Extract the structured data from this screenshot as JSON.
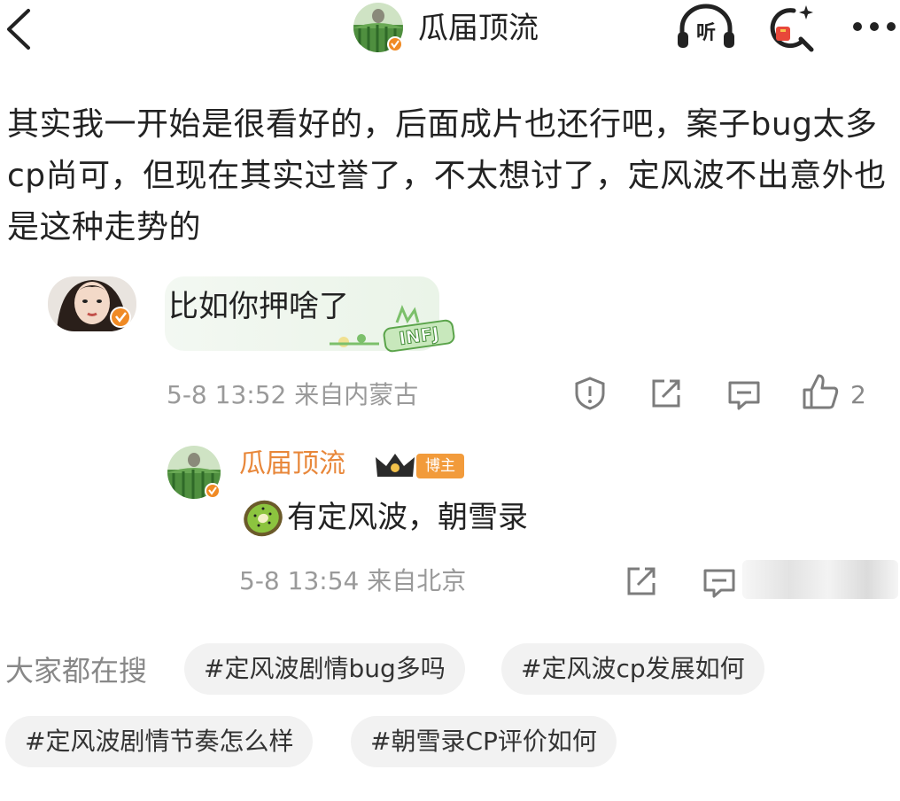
{
  "header": {
    "title": "瓜届顶流",
    "listen_label": "听"
  },
  "post": {
    "text": "其实我一开始是很看好的，后面成片也还行吧，案子bug太多cp尚可，但现在其实过誉了，不太想讨了，定风波不出意外也是这种走势的"
  },
  "reply": {
    "text": "比如你押啥了",
    "decoration_text": "INFJ",
    "meta": "5-8 13:52 来自内蒙古",
    "like_count": "2"
  },
  "nested_reply": {
    "author": "瓜届顶流",
    "badge": "博主",
    "text": "有定风波，朝雪录",
    "meta": "5-8 13:54 来自北京"
  },
  "search": {
    "label": "大家都在搜",
    "chips": [
      "#定风波剧情bug多吗",
      "#定风波cp发展如何",
      "#定风波剧情节奏怎么样",
      "#朝雪录CP评价如何"
    ]
  },
  "colors": {
    "accent_orange": "#e8873a",
    "badge_orange": "#f29b3b",
    "chip_bg": "#f2f2f2",
    "meta_gray": "#9a9a9a"
  }
}
